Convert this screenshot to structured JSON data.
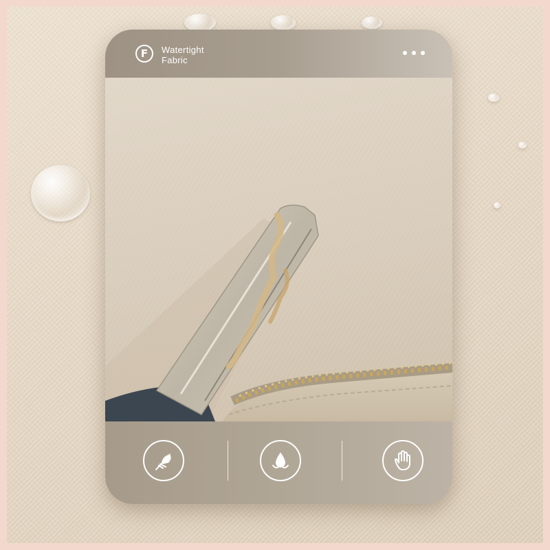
{
  "badge": {
    "logo_letter": "F",
    "line1": "Watertight",
    "line2": "Fabric"
  },
  "menu": {
    "icon": "more-dots-icon"
  },
  "features": [
    {
      "icon": "feather-icon"
    },
    {
      "icon": "water-drop-icon"
    },
    {
      "icon": "hand-icon"
    }
  ],
  "colors": {
    "background_border": "#f3d9cd",
    "card_header": "#a89e90",
    "card_footer": "#b0a696",
    "icon_stroke": "#ffffff"
  }
}
